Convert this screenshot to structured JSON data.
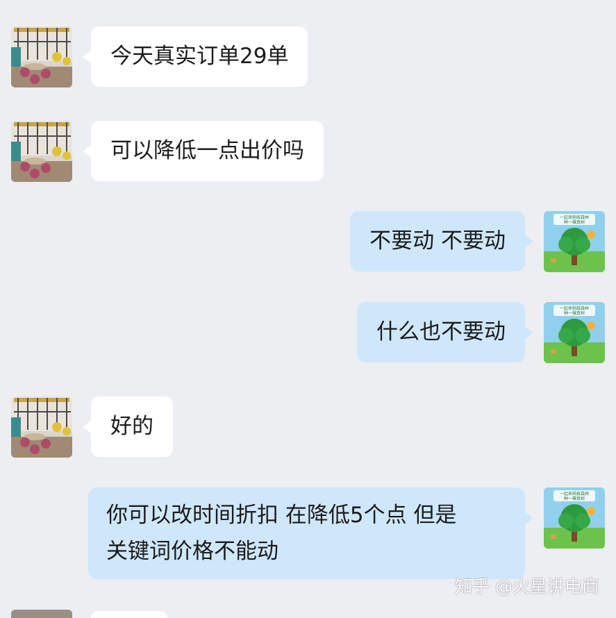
{
  "messages": [
    {
      "side": "in",
      "text": "今天真实订单29单"
    },
    {
      "side": "in",
      "text": "可以降低一点出价吗"
    },
    {
      "side": "out",
      "text": "不要动  不要动"
    },
    {
      "side": "out",
      "text": "什么也不要动"
    },
    {
      "side": "in",
      "text": "好的"
    },
    {
      "side": "out",
      "line1": "你可以改时间折扣   在降低5个点  但是",
      "line2": "关键词价格不能动"
    }
  ],
  "avatar_out_caption": {
    "line1": "一起来蚂蚁森林",
    "line2": "种一棵真树"
  },
  "watermark": "知乎 @火星讲电商",
  "colors": {
    "background": "#edeef2",
    "bubble_in": "#ffffff",
    "bubble_out": "#cfe7fb"
  }
}
